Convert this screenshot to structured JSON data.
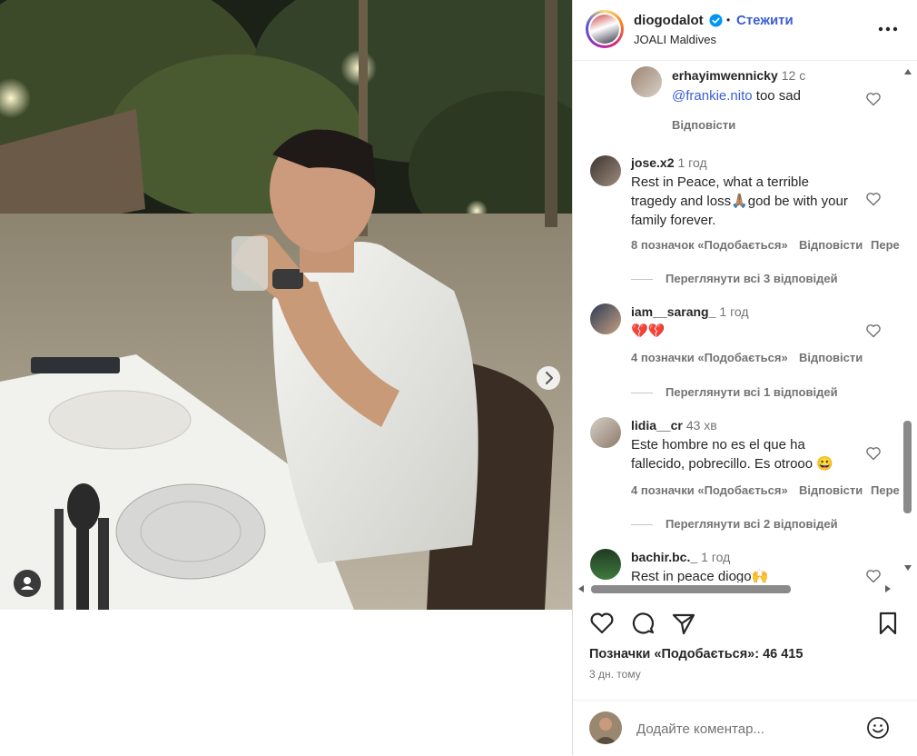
{
  "post": {
    "username": "diogodalot",
    "dot": "•",
    "follow_label": "Стежити",
    "location": "JOALI Maldives",
    "likes_text": "Позначки «Подобається»: 46 415",
    "date": "3 дн. тому"
  },
  "comments": [
    {
      "user": "erhayimwennicky",
      "time": "12 с",
      "mention": "@frankie.nito",
      "text": " too sad",
      "reply_label": "Відповісти"
    },
    {
      "user": "jose.x2",
      "time": "1 год",
      "text": "Rest in Peace, what a terrible tragedy and loss🙏🏽god be with your family forever.",
      "likes_label": "8 позначок «Подобається»",
      "reply_label": "Відповісти",
      "extra_label": "Пере",
      "view_replies": "Переглянути всі 3 відповідей"
    },
    {
      "user": "iam__sarang_",
      "time": "1 год",
      "text": "💔💔",
      "likes_label": "4 позначки «Подобається»",
      "reply_label": "Відповісти",
      "view_replies": "Переглянути всі 1 відповідей"
    },
    {
      "user": "lidia__cr",
      "time": "43 хв",
      "text": "Este hombre no es el que ha fallecido, pobrecillo. Es otrooo 😀",
      "likes_label": "4 позначки «Подобається»",
      "reply_label": "Відповісти",
      "extra_label": "Пере",
      "view_replies": "Переглянути всі 2 відповідей"
    },
    {
      "user": "bachir.bc._",
      "time": "1 год",
      "text": "Rest in peace diogo🙌"
    }
  ],
  "composer": {
    "placeholder": "Додайте коментар..."
  },
  "icons": {
    "verified": "verified-badge-icon",
    "more": "more-options-icon",
    "like": "heart-icon",
    "comment": "comment-icon",
    "share": "share-icon",
    "save": "bookmark-icon",
    "emoji": "emoji-icon",
    "next": "chevron-right-icon",
    "tag": "user-tag-icon"
  },
  "colors": {
    "accent": "#3b5fd4",
    "verified": "#0095f6",
    "muted": "#737373"
  }
}
